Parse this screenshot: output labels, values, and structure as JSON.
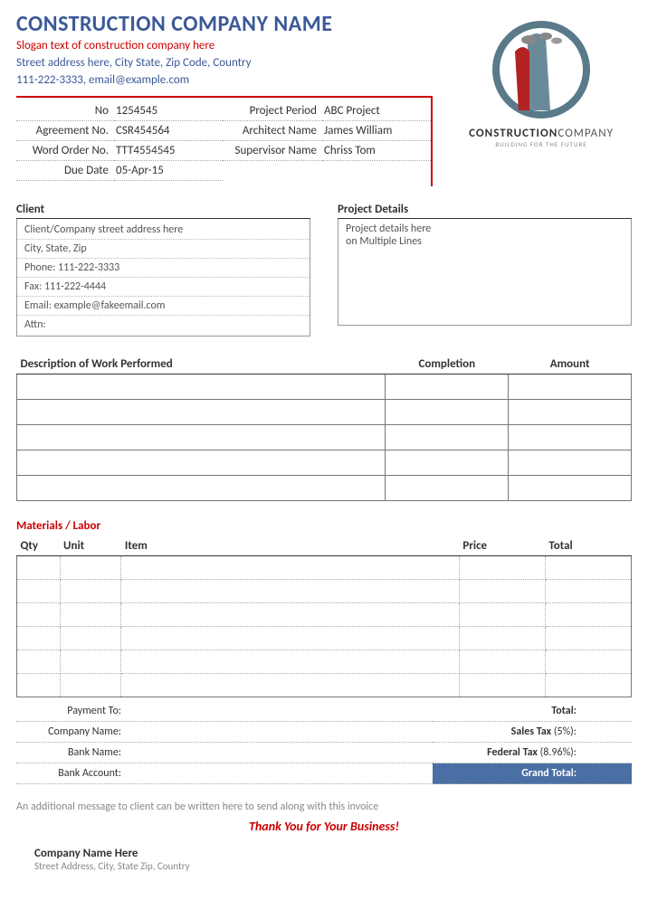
{
  "header": {
    "company_name": "CONSTRUCTION COMPANY NAME",
    "slogan": "Slogan text of construction company here",
    "address": "Street address here, City State, Zip Code, Country",
    "contact": "111-222-3333, email@example.com",
    "logo_brand_1": "CONSTRUCTION",
    "logo_brand_2": "COMPANY",
    "logo_tagline": "BUILDING FOR THE FUTURE"
  },
  "meta": {
    "no_label": "No",
    "no_value": "1254545",
    "agreement_label": "Agreement No.",
    "agreement_value": "CSR454564",
    "wordorder_label": "Word Order No.",
    "wordorder_value": "TTT4554545",
    "duedate_label": "Due Date",
    "duedate_value": "05-Apr-15",
    "period_label": "Project Period",
    "period_value": "ABC Project",
    "architect_label": "Architect Name",
    "architect_value": "James William",
    "supervisor_label": "Supervisor Name",
    "supervisor_value": "Chriss Tom"
  },
  "client": {
    "title": "Client",
    "line1": "Client/Company street address here",
    "line2": "City, State, Zip",
    "line3": "Phone: 111-222-3333",
    "line4": "Fax: 111-222-4444",
    "line5": "Email: example@fakeemail.com",
    "line6": "Attn:"
  },
  "project": {
    "title": "Project Details",
    "line1": "Project details here",
    "line2": "on Multiple Lines"
  },
  "work": {
    "title": "Description of Work Performed",
    "col_completion": "Completion",
    "col_amount": "Amount"
  },
  "materials": {
    "title": "Materials / Labor",
    "col_qty": "Qty",
    "col_unit": "Unit",
    "col_item": "Item",
    "col_price": "Price",
    "col_total": "Total"
  },
  "payment": {
    "to_label": "Payment To:",
    "company_label": "Company Name:",
    "bank_label": "Bank Name:",
    "account_label": "Bank Account:"
  },
  "totals": {
    "total_label": "Total:",
    "sales_tax_label": "Sales Tax",
    "sales_tax_rate": "(5%):",
    "federal_tax_label": "Federal Tax",
    "federal_tax_rate": "(8.96%):",
    "grand_label": "Grand Total:"
  },
  "footer": {
    "message": "An additional message to client can be written here to send along with this invoice",
    "thanks": "Thank You for Your Business!",
    "company": "Company Name Here",
    "address": "Street Address, City, State Zip, Country"
  }
}
